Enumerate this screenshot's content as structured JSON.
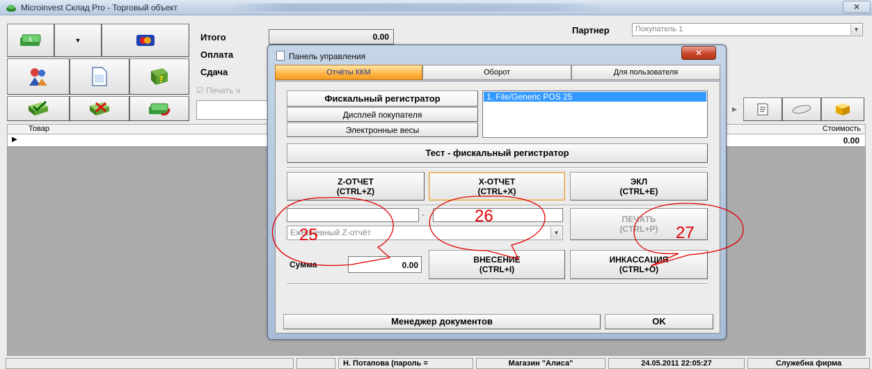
{
  "window": {
    "title": "Microinvest Склад Pro - Торговый объект",
    "close_label": "✕"
  },
  "totals": {
    "total_label": "Итого",
    "total_value": "0.00",
    "payment_label": "Оплата",
    "change_label": "Сдача",
    "print_label": "Печать ч"
  },
  "partner": {
    "label": "Партнер",
    "value": "Покупатель 1"
  },
  "grid": {
    "col_item": "Товар",
    "col_cost": "Стоимость",
    "row_cost": "0.00"
  },
  "statusbar": {
    "user": "Н. Потапова  (пароль =",
    "store": "Магазин \"Алиса\"",
    "datetime": "24.05.2011 22:05:27",
    "company": "Служебна фирма"
  },
  "dialog": {
    "title": "Панель управления",
    "close_label": "✕",
    "tabs": [
      {
        "label": "Отчёты ККМ",
        "active": true
      },
      {
        "label": "Оборот",
        "active": false
      },
      {
        "label": "Для пользователя",
        "active": false
      }
    ],
    "devices": [
      "Фискальный регистратор",
      "Дисплей покупателя",
      "Электронные весы"
    ],
    "device_list_item": "1. File/Generic POS 25",
    "test_button": "Тест - фискальный регистратор",
    "z_report": {
      "line1": "Z-ОТЧЕТ",
      "line2": "(CTRL+Z)"
    },
    "x_report": {
      "line1": "X-ОТЧЕТ",
      "line2": "(CTRL+X)"
    },
    "ekl": {
      "line1": "ЭКЛ",
      "line2": "(CTRL+E)"
    },
    "report_combo": "Ежедневный Z-отчёт",
    "print_button": {
      "line1": "ПЕЧАТЬ",
      "line2": "(CTRL+P)"
    },
    "sum_label": "Сумма",
    "sum_value": "0.00",
    "deposit_button": {
      "line1": "ВНЕСЕНИЕ",
      "line2": "(CTRL+I)"
    },
    "collection_button": {
      "line1": "ИНКАССАЦИЯ",
      "line2": "(CTRL+O)"
    },
    "doc_manager_button": "Менеджер документов",
    "ok_button": "OK"
  },
  "annotations": {
    "n25": "25",
    "n26": "26",
    "n27": "27",
    "color": "#e10000"
  }
}
